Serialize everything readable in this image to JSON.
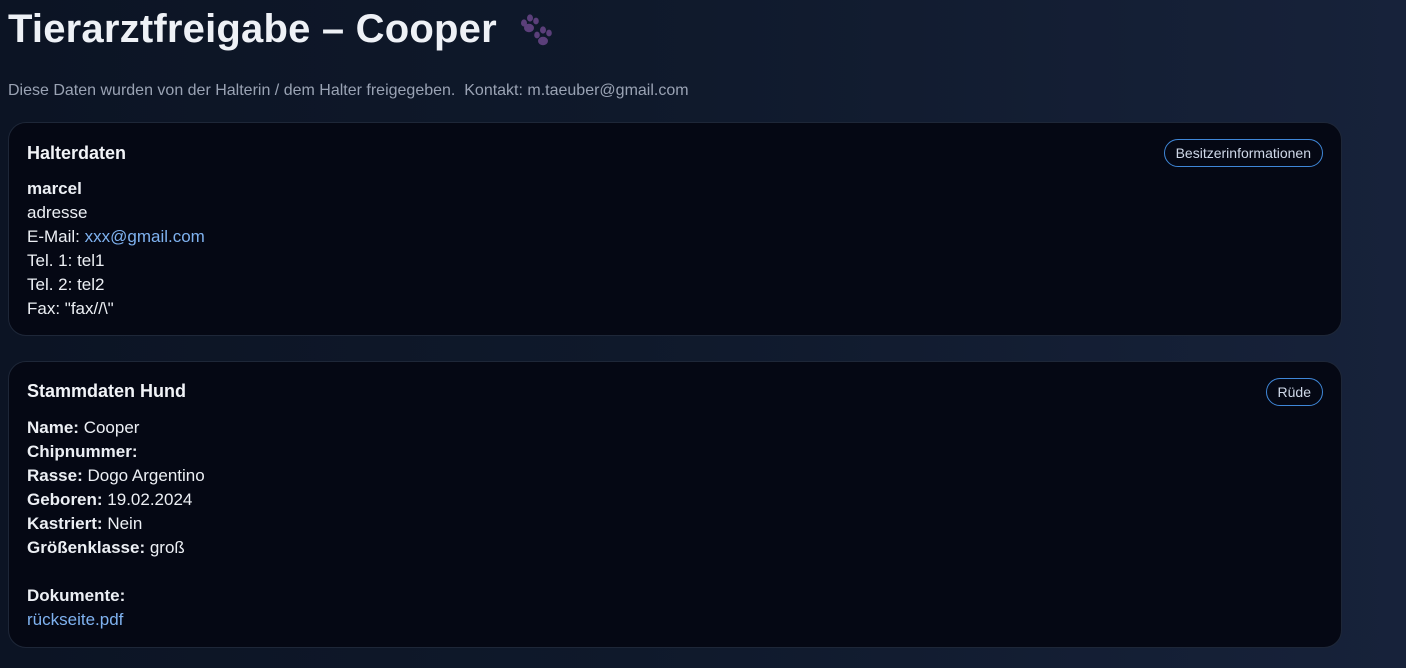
{
  "header": {
    "title": "Tierarztfreigabe – Cooper",
    "paw_icon": "paw-prints-icon",
    "subtitle": "Diese Daten wurden von der Halterin / dem Halter freigegeben.  Kontakt: m.taeuber@gmail.com"
  },
  "owner_card": {
    "title": "Halterdaten",
    "badge": "Besitzerinformationen",
    "name": "marcel",
    "address": "adresse",
    "email_label": "E-Mail: ",
    "email": "xxx@gmail.com",
    "tel1": "Tel. 1: tel1",
    "tel2": "Tel. 2: tel2",
    "fax": "Fax: \"fax//\\\""
  },
  "dog_card": {
    "title": "Stammdaten Hund",
    "badge": "Rüde",
    "fields": [
      {
        "label": "Name:",
        "value": " Cooper"
      },
      {
        "label": "Chipnummer:",
        "value": ""
      },
      {
        "label": "Rasse:",
        "value": " Dogo Argentino"
      },
      {
        "label": "Geboren:",
        "value": " 19.02.2024"
      },
      {
        "label": "Kastriert:",
        "value": " Nein"
      },
      {
        "label": "Größenklasse:",
        "value": " groß"
      }
    ],
    "documents_label": "Dokumente:",
    "documents": [
      "rückseite.pdf"
    ]
  },
  "colors": {
    "background": "#0f192b",
    "card": "#050814",
    "accent_border": "#3f87d8",
    "link": "#7fb2f0",
    "paw": "#5b3f7a"
  }
}
